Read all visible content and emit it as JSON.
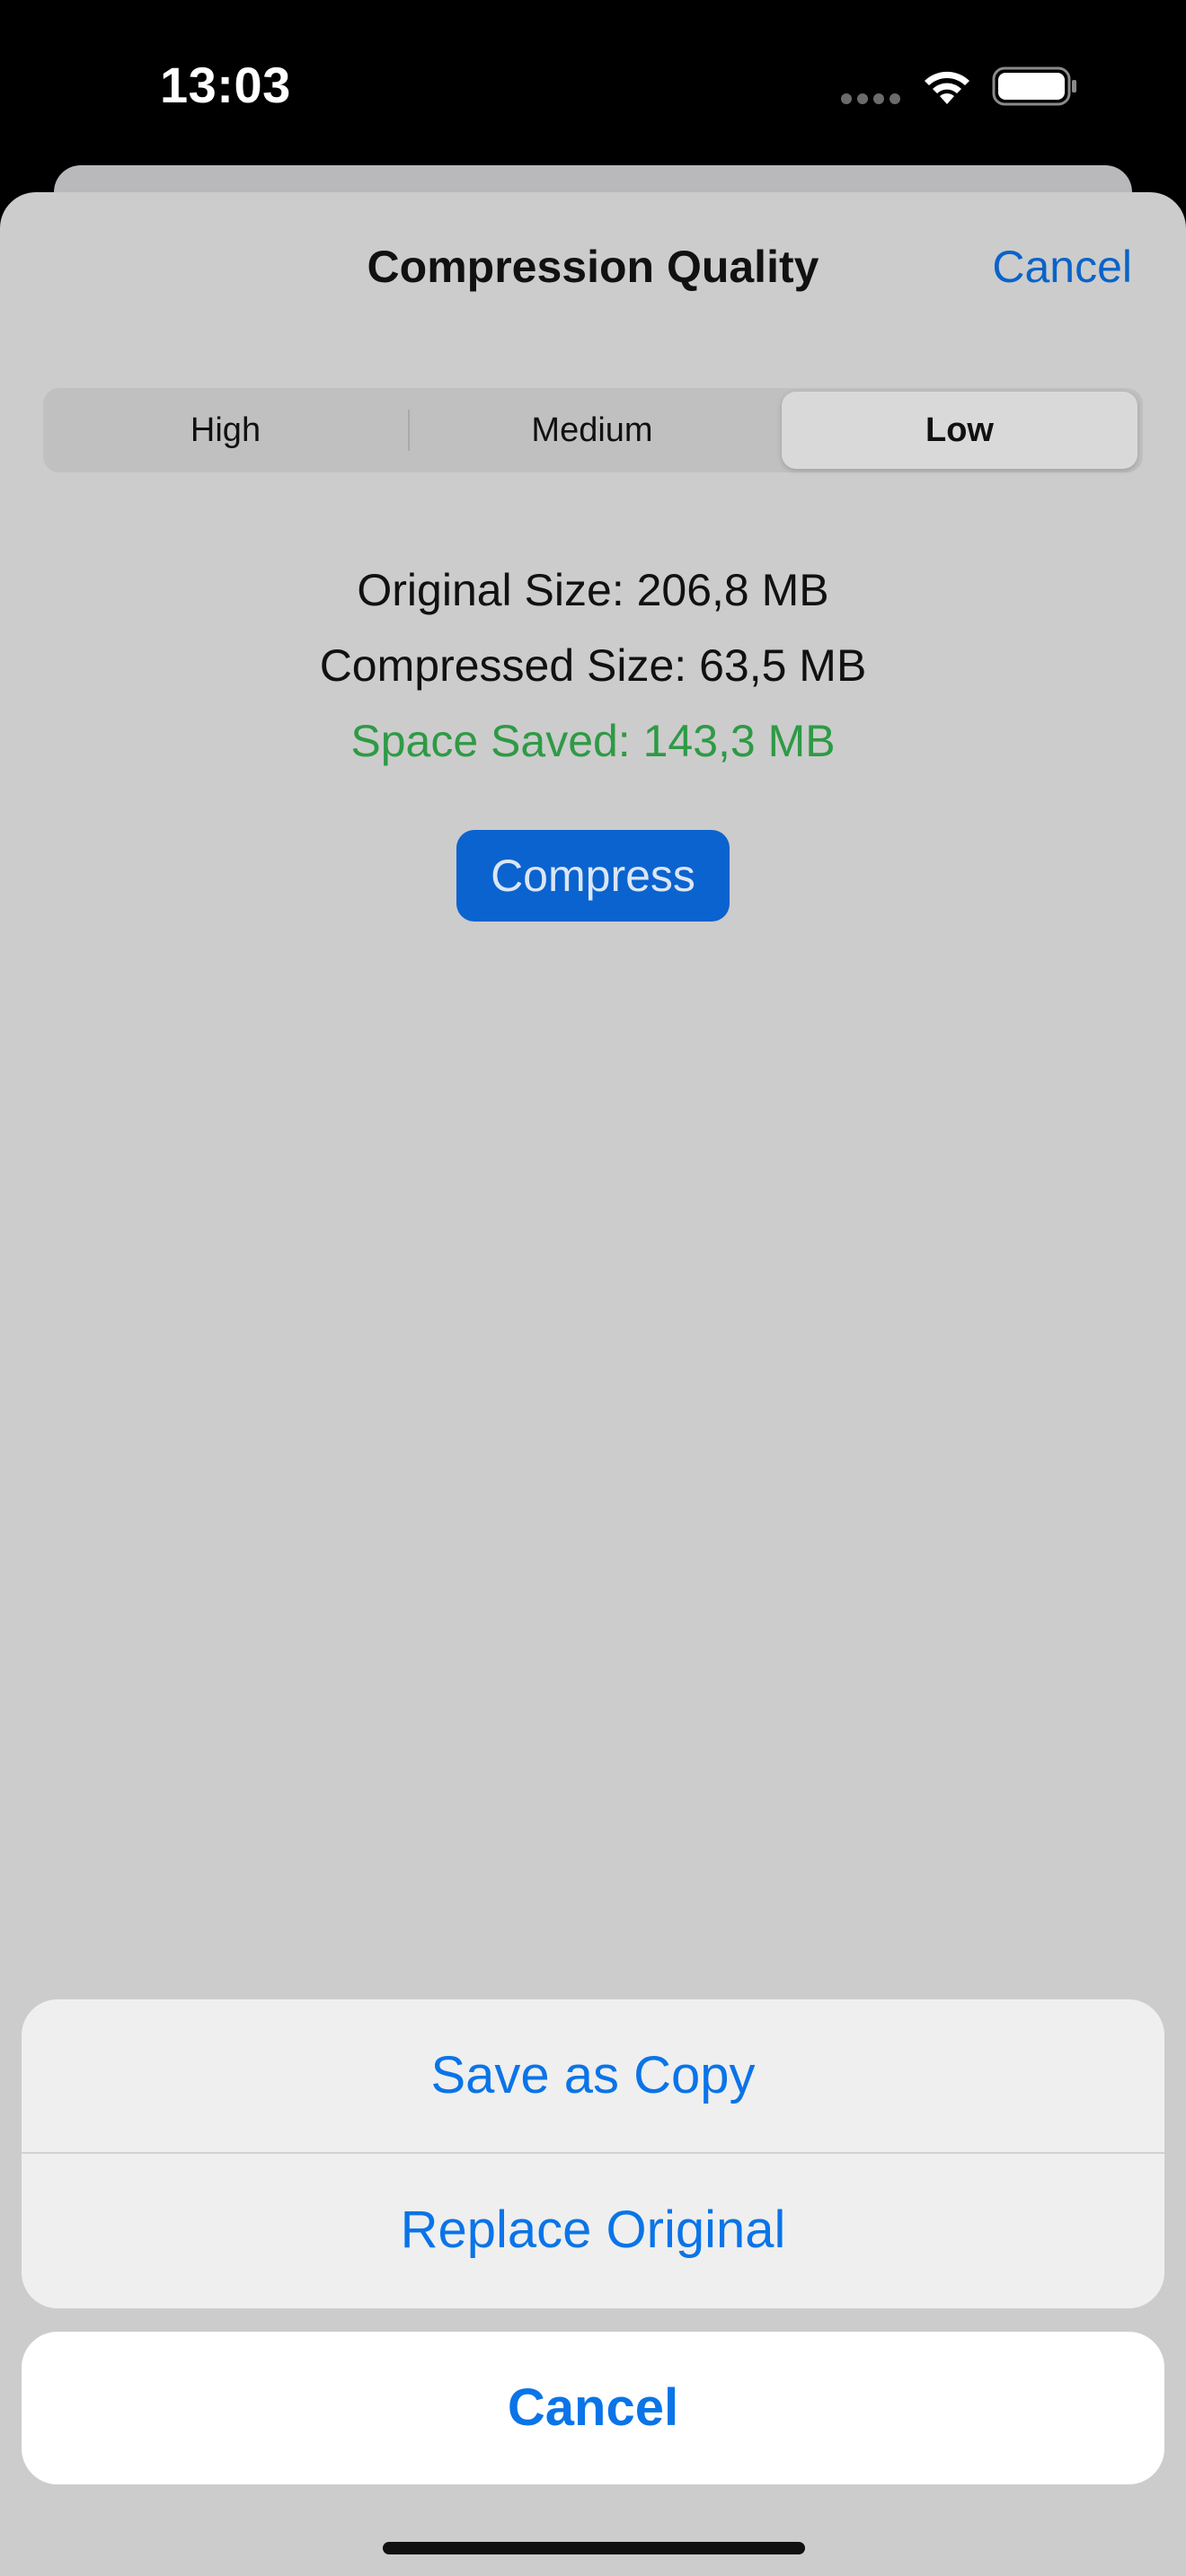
{
  "status_bar": {
    "time": "13:03",
    "icons": [
      "signal-dots-icon",
      "wifi-icon",
      "battery-icon"
    ]
  },
  "sheet": {
    "title": "Compression Quality",
    "cancel_label": "Cancel",
    "segments": [
      {
        "label": "High",
        "selected": false
      },
      {
        "label": "Medium",
        "selected": false
      },
      {
        "label": "Low",
        "selected": true
      }
    ],
    "info": {
      "original": "Original Size: 206,8 MB",
      "compressed": "Compressed Size: 63,5 MB",
      "saved": "Space Saved: 143,3 MB"
    },
    "compress_label": "Compress"
  },
  "action_sheet": {
    "save_copy_label": "Save as Copy",
    "replace_label": "Replace Original",
    "cancel_label": "Cancel"
  },
  "colors": {
    "accent": "#0a74e8",
    "saved_green": "#2e9a45",
    "compress_button": "#0b63cf",
    "sheet_background": "#cccccc"
  }
}
